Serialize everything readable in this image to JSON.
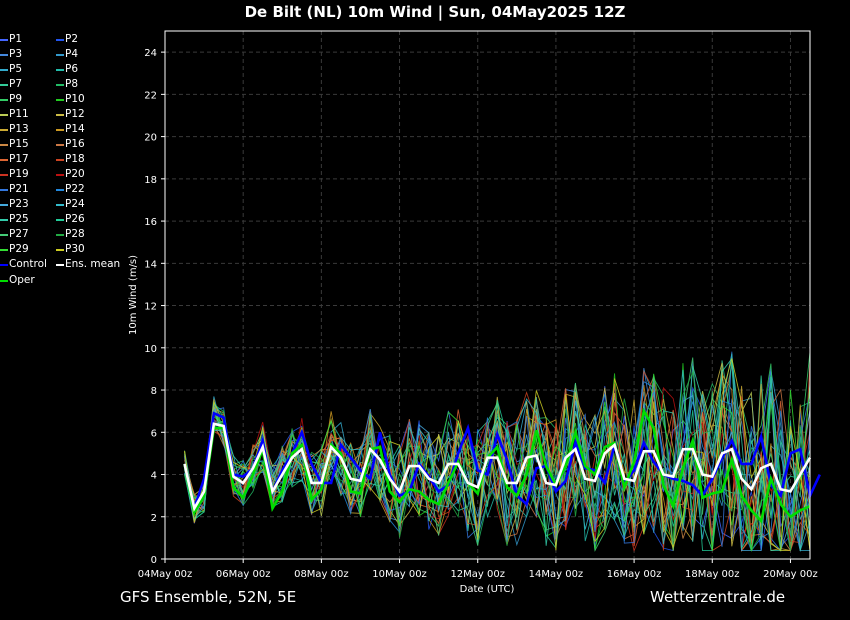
{
  "title": "De Bilt  (NL)  10m Wind | Sun, 04May2025 12Z",
  "footer": {
    "left": "GFS Ensemble, 52N, 5E",
    "right": "Wetterzentrale.de"
  },
  "chart_data": {
    "type": "line",
    "xlabel": "Date (UTC)",
    "ylabel": "10m Wind (m/s)",
    "ylim": [
      0,
      25
    ],
    "xlim": [
      "2025-05-04 00z",
      "2025-05-20 12z"
    ],
    "x_ticks": [
      "04May 00z",
      "06May 00z",
      "08May 00z",
      "10May 00z",
      "12May 00z",
      "14May 00z",
      "16May 00z",
      "18May 00z",
      "20May 00z"
    ],
    "y_ticks": [
      0,
      2,
      4,
      6,
      8,
      10,
      12,
      14,
      16,
      18,
      20,
      22,
      24
    ],
    "grid": true,
    "legend_position": "left, outside plot",
    "x_times": [
      "04May 12z",
      "04May 18z",
      "05May 00z",
      "05May 06z",
      "05May 12z",
      "05May 18z",
      "06May 00z",
      "06May 06z",
      "06May 12z",
      "06May 18z",
      "07May 00z",
      "07May 06z",
      "07May 12z",
      "07May 18z",
      "08May 00z",
      "08May 06z",
      "08May 12z",
      "08May 18z",
      "09May 00z",
      "09May 06z",
      "09May 12z",
      "09May 18z",
      "10May 00z",
      "10May 06z",
      "10May 12z",
      "10May 18z",
      "11May 00z",
      "11May 06z",
      "11May 12z",
      "11May 18z",
      "12May 00z",
      "12May 06z",
      "12May 12z",
      "12May 18z",
      "13May 00z",
      "13May 06z",
      "13May 12z",
      "13May 18z",
      "14May 00z",
      "14May 06z",
      "14May 12z",
      "14May 18z",
      "15May 00z",
      "15May 06z",
      "15May 12z",
      "15May 18z",
      "16May 00z",
      "16May 06z",
      "16May 12z",
      "16May 18z",
      "17May 00z",
      "17May 06z",
      "17May 12z",
      "17May 18z",
      "18May 00z",
      "18May 06z",
      "18May 12z",
      "18May 18z",
      "19May 00z",
      "19May 06z",
      "19May 12z",
      "19May 18z",
      "20May 00z",
      "20May 06z",
      "20May 12z"
    ],
    "series": [
      {
        "name": "P1",
        "color": "#4466ff"
      },
      {
        "name": "P2",
        "color": "#2255ee"
      },
      {
        "name": "P3",
        "color": "#4488dd"
      },
      {
        "name": "P4",
        "color": "#3399cc"
      },
      {
        "name": "P5",
        "color": "#33aacc"
      },
      {
        "name": "P6",
        "color": "#22bbaa"
      },
      {
        "name": "P7",
        "color": "#33cc99"
      },
      {
        "name": "P8",
        "color": "#22bb66"
      },
      {
        "name": "P9",
        "color": "#33cc66"
      },
      {
        "name": "P10",
        "color": "#22cc22"
      },
      {
        "name": "P11",
        "color": "#bbcc55"
      },
      {
        "name": "P12",
        "color": "#ccbb44"
      },
      {
        "name": "P13",
        "color": "#ccaa33"
      },
      {
        "name": "P14",
        "color": "#cc9922"
      },
      {
        "name": "P15",
        "color": "#cc8844"
      },
      {
        "name": "P16",
        "color": "#cc7744"
      },
      {
        "name": "P17",
        "color": "#dd6633"
      },
      {
        "name": "P18",
        "color": "#cc4422"
      },
      {
        "name": "P19",
        "color": "#cc3322"
      },
      {
        "name": "P20",
        "color": "#bb1111"
      },
      {
        "name": "P21",
        "color": "#3377dd"
      },
      {
        "name": "P22",
        "color": "#2288dd"
      },
      {
        "name": "P23",
        "color": "#44aadd"
      },
      {
        "name": "P24",
        "color": "#33bbcc"
      },
      {
        "name": "P25",
        "color": "#33ccaa"
      },
      {
        "name": "P26",
        "color": "#22cc99"
      },
      {
        "name": "P27",
        "color": "#44cc77"
      },
      {
        "name": "P28",
        "color": "#22aa44"
      },
      {
        "name": "P29",
        "color": "#33dd33"
      },
      {
        "name": "P30",
        "color": "#cccc22"
      },
      {
        "name": "Control",
        "color": "#0000ff",
        "values": [
          4.5,
          2.4,
          3.8,
          6.9,
          6.7,
          4.0,
          3.9,
          4.3,
          5.6,
          3.2,
          4.2,
          5.0,
          6.0,
          4.5,
          3.6,
          3.6,
          5.4,
          4.8,
          4.2,
          3.8,
          6.0,
          4.0,
          3.0,
          3.2,
          4.5,
          3.9,
          3.2,
          3.5,
          5.0,
          6.2,
          4.2,
          4.0,
          5.9,
          4.7,
          3.0,
          2.6,
          4.3,
          4.4,
          3.2,
          3.7,
          5.5,
          4.3,
          4.2,
          3.6,
          5.4,
          3.6,
          4.2,
          5.5,
          4.6,
          4.0,
          3.8,
          3.7,
          3.5,
          3.0,
          3.8,
          4.8,
          5.6,
          4.5,
          4.5,
          5.8,
          3.5,
          3.0,
          5.0,
          5.2,
          3.0,
          4.0
        ]
      },
      {
        "name": "Ens. mean",
        "color": "#ffffff",
        "values": [
          4.5,
          2.4,
          3.2,
          6.4,
          6.3,
          3.9,
          3.6,
          4.3,
          5.3,
          3.2,
          4.0,
          4.8,
          5.2,
          3.6,
          3.6,
          5.3,
          4.8,
          3.8,
          3.7,
          5.2,
          4.7,
          3.8,
          3.2,
          4.4,
          4.4,
          3.8,
          3.6,
          4.5,
          4.5,
          3.6,
          3.4,
          4.8,
          4.8,
          3.6,
          3.6,
          4.8,
          4.9,
          3.6,
          3.5,
          4.8,
          5.2,
          3.8,
          3.7,
          5.0,
          5.4,
          3.8,
          3.7,
          5.1,
          5.1,
          4.0,
          3.9,
          5.2,
          5.2,
          4.0,
          3.9,
          5.0,
          5.2,
          3.8,
          3.3,
          4.3,
          4.5,
          3.3,
          3.2,
          4.0,
          4.8
        ]
      },
      {
        "name": "Oper",
        "color": "#00dd00",
        "values": [
          4.5,
          2.2,
          3.0,
          6.2,
          6.2,
          3.4,
          2.9,
          4.0,
          5.2,
          2.4,
          3.2,
          5.0,
          5.4,
          2.8,
          3.3,
          5.4,
          5.0,
          3.2,
          3.1,
          5.2,
          5.3,
          3.2,
          2.7,
          3.3,
          3.2,
          2.8,
          2.6,
          3.6,
          4.6,
          3.6,
          3.1,
          4.8,
          5.3,
          3.4,
          3.0,
          4.0,
          6.1,
          4.4,
          3.5,
          4.4,
          6.0,
          4.4,
          4.0,
          5.3,
          5.5,
          3.4,
          4.6,
          7.0,
          6.2,
          3.5,
          2.5,
          4.3,
          5.6,
          2.9,
          3.1,
          3.2,
          4.7,
          3.0,
          2.3,
          1.8,
          3.8,
          2.6,
          2.0,
          2.3,
          2.5
        ]
      }
    ]
  }
}
